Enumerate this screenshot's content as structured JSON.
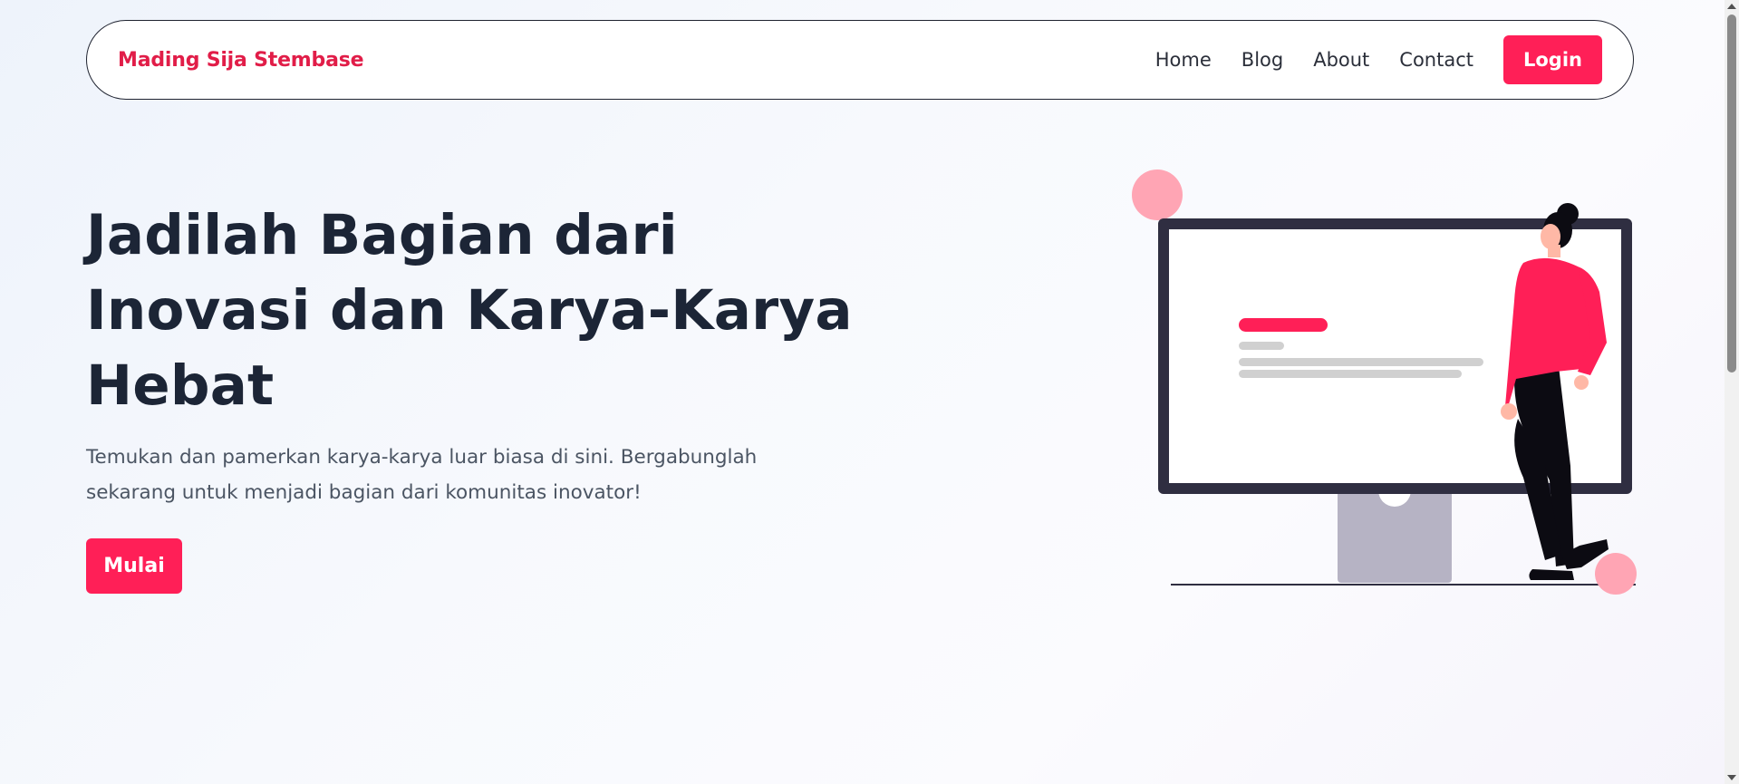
{
  "navbar": {
    "brand": "Mading Sija Stembase",
    "links": [
      "Home",
      "Blog",
      "About",
      "Contact"
    ],
    "login_label": "Login"
  },
  "hero": {
    "title": "Jadilah Bagian dari Inovasi dan Karya-Karya Hebat",
    "description": "Temukan dan pamerkan karya-karya luar biasa di sini. Bergabunglah sekarang untuk menjadi bagian dari komunitas inovator!",
    "cta_label": "Mulai"
  },
  "colors": {
    "accent": "#ff1f57",
    "brand": "#e11d48",
    "heading": "#1c2536",
    "text": "#4b5563"
  },
  "illustration": {
    "name": "person-presenting-monitor-illustration"
  }
}
